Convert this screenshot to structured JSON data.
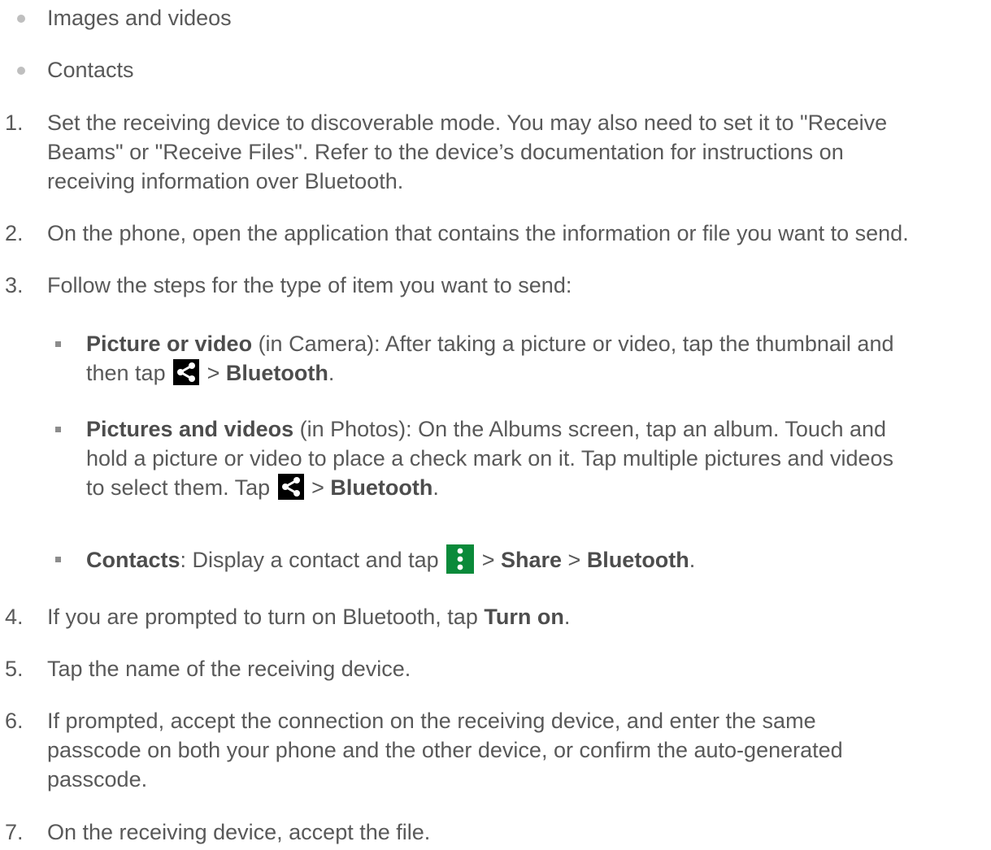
{
  "bullets": [
    "Images and videos",
    "Contacts"
  ],
  "steps": [
    {
      "num": "1.",
      "line1": "Set the receiving device to discoverable mode. You may also need to set it to \"Receive",
      "line2": "Beams\" or \"Receive Files\". Refer to the device’s documentation for instructions on",
      "line3": "receiving information over Bluetooth."
    },
    {
      "num": "2.",
      "line1": "On the phone, open the application that contains the information or file you want to send."
    },
    {
      "num": "3.",
      "line1": "Follow the steps for the type of item you want to send:"
    },
    {
      "num": "4.",
      "pre": "If you are prompted to turn on Bluetooth, tap ",
      "bold": "Turn on",
      "post": "."
    },
    {
      "num": "5.",
      "line1": "Tap the name of the receiving device."
    },
    {
      "num": "6.",
      "line1": "If prompted, accept the connection on the receiving device, and enter the same",
      "line2": "passcode on both your phone and the other device, or confirm the auto-generated",
      "line3": "passcode."
    },
    {
      "num": "7.",
      "line1": "On the receiving device, accept the file."
    }
  ],
  "substeps": {
    "picture": {
      "bold": "Picture or video",
      "rest1": " (in Camera): After taking a picture or video, tap the thumbnail and",
      "then": "then tap ",
      "gt": " > ",
      "bt": "Bluetooth",
      "dot": "."
    },
    "pictures": {
      "bold": "Pictures and videos",
      "rest1": " (in Photos): On the Albums screen, tap an album. Touch and",
      "line2": "hold a picture or video to place a check mark on it. Tap multiple pictures and videos",
      "line3pre": "to select them. Tap ",
      "gt": " > ",
      "bt": "Bluetooth",
      "dot": "."
    },
    "contacts": {
      "bold": "Contacts",
      "rest1": ": Display a contact and tap ",
      "gt1": " > ",
      "share": "Share",
      "gt2": " > ",
      "bt": "Bluetooth",
      "dot": "."
    }
  },
  "icons": {
    "share": "share-icon",
    "menu": "more-vert-icon",
    "share_bg": "#000000",
    "menu_bg": "#0a8a3a"
  }
}
